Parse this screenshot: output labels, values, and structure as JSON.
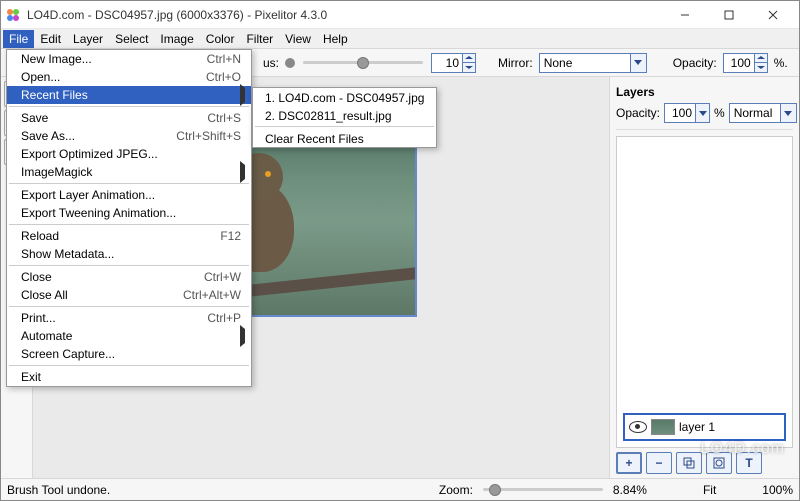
{
  "window": {
    "title": "LO4D.com - DSC04957.jpg (6000x3376) - Pixelitor 4.3.0"
  },
  "menubar": [
    "File",
    "Edit",
    "Layer",
    "Select",
    "Image",
    "Color",
    "Filter",
    "View",
    "Help"
  ],
  "toolbar": {
    "us_label": "us:",
    "value": "10",
    "mirror_label": "Mirror:",
    "mirror_value": "None",
    "opacity_label": "Opacity:",
    "opacity_value": "100",
    "opacity_suffix": "%."
  },
  "file_menu": [
    {
      "type": "item",
      "label": "New Image...",
      "accel": "Ctrl+N"
    },
    {
      "type": "item",
      "label": "Open...",
      "accel": "Ctrl+O"
    },
    {
      "type": "item",
      "label": "Recent Files",
      "arrow": true,
      "hl": true
    },
    {
      "type": "sep"
    },
    {
      "type": "item",
      "label": "Save",
      "accel": "Ctrl+S"
    },
    {
      "type": "item",
      "label": "Save As...",
      "accel": "Ctrl+Shift+S"
    },
    {
      "type": "item",
      "label": "Export Optimized JPEG..."
    },
    {
      "type": "item",
      "label": "ImageMagick",
      "arrow": true
    },
    {
      "type": "sep"
    },
    {
      "type": "item",
      "label": "Export Layer Animation..."
    },
    {
      "type": "item",
      "label": "Export Tweening Animation..."
    },
    {
      "type": "sep"
    },
    {
      "type": "item",
      "label": "Reload",
      "accel": "F12"
    },
    {
      "type": "item",
      "label": "Show Metadata..."
    },
    {
      "type": "sep"
    },
    {
      "type": "item",
      "label": "Close",
      "accel": "Ctrl+W"
    },
    {
      "type": "item",
      "label": "Close All",
      "accel": "Ctrl+Alt+W"
    },
    {
      "type": "sep"
    },
    {
      "type": "item",
      "label": "Print...",
      "accel": "Ctrl+P"
    },
    {
      "type": "item",
      "label": "Automate",
      "arrow": true
    },
    {
      "type": "item",
      "label": "Screen Capture..."
    },
    {
      "type": "sep"
    },
    {
      "type": "item",
      "label": "Exit"
    }
  ],
  "recent_submenu": {
    "items": [
      "1. LO4D.com - DSC04957.jpg",
      "2. DSC02811_result.jpg"
    ],
    "clear": "Clear Recent Files"
  },
  "layers_panel": {
    "title": "Layers",
    "opacity_label": "Opacity:",
    "opacity_value": "100",
    "percent": "%",
    "blend_mode": "Normal",
    "layer_name": "layer 1"
  },
  "status": {
    "message": "Brush Tool undone.",
    "zoom_label": "Zoom:",
    "zoom_value": "8.84%",
    "fit": "Fit",
    "max": "100%"
  },
  "watermark": "LO4D.com"
}
